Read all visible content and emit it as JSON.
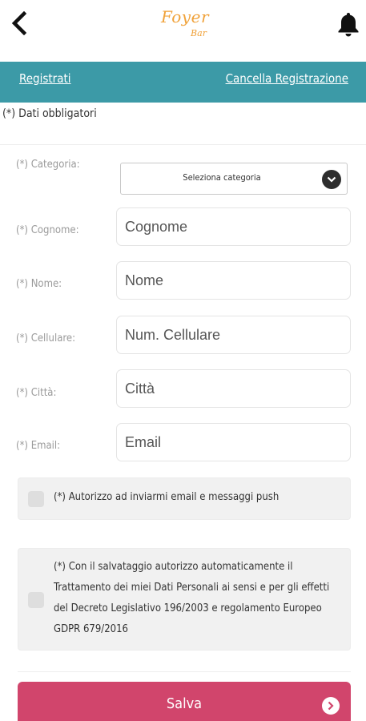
{
  "header": {
    "logo_line1": "Foyer",
    "logo_line2": "Bar",
    "back_icon": "chevron-left-icon",
    "bell_icon": "bell-icon"
  },
  "nav": {
    "register_label": "Registrati",
    "unregister_label": "Cancella Registrazione"
  },
  "required_note": "(*) Dati obbligatori",
  "form": {
    "category": {
      "label": "(*) Categoria:",
      "selected": "Seleziona categoria"
    },
    "surname": {
      "label": "(*) Cognome:",
      "placeholder": "Cognome"
    },
    "name": {
      "label": "(*) Nome:",
      "placeholder": "Nome"
    },
    "phone": {
      "label": "(*) Cellulare:",
      "placeholder": "Num. Cellulare"
    },
    "city": {
      "label": "(*) Città:",
      "placeholder": "Città"
    },
    "email": {
      "label": "(*) Email:",
      "placeholder": "Email"
    }
  },
  "consents": {
    "push": "(*) Autorizzo ad inviarmi email e messaggi push",
    "privacy": "(*) Con il salvataggio autorizzo automaticamente il Trattamento dei miei Dati Personali ai sensi e per gli effetti del Decreto Legislativo 196/2003 e regolamento Europeo GDPR 679/2016"
  },
  "save_label": "Salva",
  "colors": {
    "nav_bg": "#3c9aa7",
    "save_bg": "#d1456c",
    "logo": "#f0a23a"
  }
}
